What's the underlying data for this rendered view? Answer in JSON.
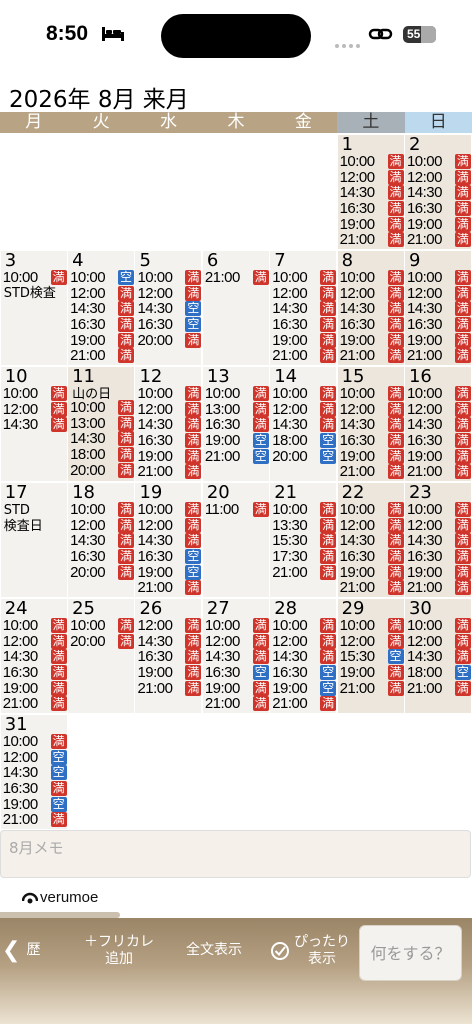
{
  "status_bar": {
    "time": "8:50",
    "battery": "55"
  },
  "month_title": "2026年 8月 来月",
  "weekdays": [
    "月",
    "火",
    "水",
    "木",
    "金",
    "土",
    "日"
  ],
  "calendar": {
    "weeks": [
      [
        null,
        null,
        null,
        null,
        null,
        {
          "day": "1",
          "kind": "weekend",
          "slots": [
            [
              "10:00",
              "満"
            ],
            [
              "12:00",
              "満"
            ],
            [
              "14:30",
              "満"
            ],
            [
              "16:30",
              "満"
            ],
            [
              "19:00",
              "満"
            ],
            [
              "21:00",
              "満"
            ]
          ]
        },
        {
          "day": "2",
          "kind": "weekend",
          "slots": [
            [
              "10:00",
              "満"
            ],
            [
              "12:00",
              "満"
            ],
            [
              "14:30",
              "満"
            ],
            [
              "16:30",
              "満"
            ],
            [
              "19:00",
              "満"
            ],
            [
              "21:00",
              "満"
            ]
          ]
        }
      ],
      [
        {
          "day": "3",
          "slots": [
            [
              "10:00",
              "満"
            ]
          ],
          "label": "STD検査"
        },
        {
          "day": "4",
          "slots": [
            [
              "10:00",
              "空"
            ],
            [
              "12:00",
              "満"
            ],
            [
              "14:30",
              "満"
            ],
            [
              "16:30",
              "満"
            ],
            [
              "19:00",
              "満"
            ],
            [
              "21:00",
              "満"
            ]
          ]
        },
        {
          "day": "5",
          "slots": [
            [
              "10:00",
              "満"
            ],
            [
              "12:00",
              "満"
            ],
            [
              "14:30",
              "空"
            ],
            [
              "16:30",
              "空"
            ],
            [
              "20:00",
              "満"
            ]
          ]
        },
        {
          "day": "6",
          "slots": [
            [
              "21:00",
              "満"
            ]
          ]
        },
        {
          "day": "7",
          "slots": [
            [
              "10:00",
              "満"
            ],
            [
              "12:00",
              "満"
            ],
            [
              "14:30",
              "満"
            ],
            [
              "16:30",
              "満"
            ],
            [
              "19:00",
              "満"
            ],
            [
              "21:00",
              "満"
            ]
          ]
        },
        {
          "day": "8",
          "kind": "weekend",
          "slots": [
            [
              "10:00",
              "満"
            ],
            [
              "12:00",
              "満"
            ],
            [
              "14:30",
              "満"
            ],
            [
              "16:30",
              "満"
            ],
            [
              "19:00",
              "満"
            ],
            [
              "21:00",
              "満"
            ]
          ]
        },
        {
          "day": "9",
          "kind": "weekend",
          "slots": [
            [
              "10:00",
              "満"
            ],
            [
              "12:00",
              "満"
            ],
            [
              "14:30",
              "満"
            ],
            [
              "16:30",
              "満"
            ],
            [
              "19:00",
              "満"
            ],
            [
              "21:00",
              "満"
            ]
          ]
        }
      ],
      [
        {
          "day": "10",
          "slots": [
            [
              "10:00",
              "満"
            ],
            [
              "12:00",
              "満"
            ],
            [
              "14:30",
              "満"
            ]
          ]
        },
        {
          "day": "11",
          "kind": "holiday",
          "label": "山の日",
          "slots": [
            [
              "10:00",
              "満"
            ],
            [
              "13:00",
              "満"
            ],
            [
              "14:30",
              "満"
            ],
            [
              "18:00",
              "満"
            ],
            [
              "20:00",
              "満"
            ]
          ]
        },
        {
          "day": "12",
          "slots": [
            [
              "10:00",
              "満"
            ],
            [
              "12:00",
              "満"
            ],
            [
              "14:30",
              "満"
            ],
            [
              "16:30",
              "満"
            ],
            [
              "19:00",
              "満"
            ],
            [
              "21:00",
              "満"
            ]
          ]
        },
        {
          "day": "13",
          "slots": [
            [
              "10:00",
              "満"
            ],
            [
              "13:00",
              "満"
            ],
            [
              "16:30",
              "満"
            ],
            [
              "19:00",
              "空"
            ],
            [
              "21:00",
              "空"
            ]
          ]
        },
        {
          "day": "14",
          "slots": [
            [
              "10:00",
              "満"
            ],
            [
              "12:00",
              "満"
            ],
            [
              "14:30",
              "満"
            ],
            [
              "18:00",
              "空"
            ],
            [
              "20:00",
              "空"
            ]
          ]
        },
        {
          "day": "15",
          "kind": "weekend",
          "slots": [
            [
              "10:00",
              "満"
            ],
            [
              "12:00",
              "満"
            ],
            [
              "14:30",
              "満"
            ],
            [
              "16:30",
              "満"
            ],
            [
              "19:00",
              "満"
            ],
            [
              "21:00",
              "満"
            ]
          ]
        },
        {
          "day": "16",
          "kind": "weekend",
          "slots": [
            [
              "10:00",
              "満"
            ],
            [
              "12:00",
              "満"
            ],
            [
              "14:30",
              "満"
            ],
            [
              "16:30",
              "満"
            ],
            [
              "19:00",
              "満"
            ],
            [
              "21:00",
              "満"
            ]
          ]
        }
      ],
      [
        {
          "day": "17",
          "slots": [],
          "label": "STD",
          "label2": "検査日"
        },
        {
          "day": "18",
          "slots": [
            [
              "10:00",
              "満"
            ],
            [
              "12:00",
              "満"
            ],
            [
              "14:30",
              "満"
            ],
            [
              "16:30",
              "満"
            ],
            [
              "20:00",
              "満"
            ]
          ]
        },
        {
          "day": "19",
          "slots": [
            [
              "10:00",
              "満"
            ],
            [
              "12:00",
              "満"
            ],
            [
              "14:30",
              "満"
            ],
            [
              "16:30",
              "空"
            ],
            [
              "19:00",
              "空"
            ],
            [
              "21:00",
              "満"
            ]
          ]
        },
        {
          "day": "20",
          "slots": [
            [
              "11:00",
              "満"
            ]
          ]
        },
        {
          "day": "21",
          "slots": [
            [
              "10:00",
              "満"
            ],
            [
              "13:30",
              "満"
            ],
            [
              "15:30",
              "満"
            ],
            [
              "17:30",
              "満"
            ],
            [
              "21:00",
              "満"
            ]
          ]
        },
        {
          "day": "22",
          "kind": "weekend",
          "slots": [
            [
              "10:00",
              "満"
            ],
            [
              "12:00",
              "満"
            ],
            [
              "14:30",
              "満"
            ],
            [
              "16:30",
              "満"
            ],
            [
              "19:00",
              "満"
            ],
            [
              "21:00",
              "満"
            ]
          ]
        },
        {
          "day": "23",
          "kind": "weekend",
          "slots": [
            [
              "10:00",
              "満"
            ],
            [
              "12:00",
              "満"
            ],
            [
              "14:30",
              "満"
            ],
            [
              "16:30",
              "満"
            ],
            [
              "19:00",
              "満"
            ],
            [
              "21:00",
              "満"
            ]
          ]
        }
      ],
      [
        {
          "day": "24",
          "slots": [
            [
              "10:00",
              "満"
            ],
            [
              "12:00",
              "満"
            ],
            [
              "14:30",
              "満"
            ],
            [
              "16:30",
              "満"
            ],
            [
              "19:00",
              "満"
            ],
            [
              "21:00",
              "満"
            ]
          ]
        },
        {
          "day": "25",
          "slots": [
            [
              "10:00",
              "満"
            ],
            [
              "20:00",
              "満"
            ]
          ]
        },
        {
          "day": "26",
          "slots": [
            [
              "12:00",
              "満"
            ],
            [
              "14:30",
              "満"
            ],
            [
              "16:30",
              "満"
            ],
            [
              "19:00",
              "満"
            ],
            [
              "21:00",
              "満"
            ]
          ]
        },
        {
          "day": "27",
          "slots": [
            [
              "10:00",
              "満"
            ],
            [
              "12:00",
              "満"
            ],
            [
              "14:30",
              "満"
            ],
            [
              "16:30",
              "空"
            ],
            [
              "19:00",
              "満"
            ],
            [
              "21:00",
              "満"
            ]
          ]
        },
        {
          "day": "28",
          "slots": [
            [
              "10:00",
              "満"
            ],
            [
              "12:00",
              "満"
            ],
            [
              "14:30",
              "満"
            ],
            [
              "16:30",
              "空"
            ],
            [
              "19:00",
              "空"
            ],
            [
              "21:00",
              "満"
            ]
          ]
        },
        {
          "day": "29",
          "kind": "weekend",
          "slots": [
            [
              "10:00",
              "満"
            ],
            [
              "12:00",
              "満"
            ],
            [
              "15:30",
              "空"
            ],
            [
              "19:00",
              "満"
            ],
            [
              "21:00",
              "満"
            ]
          ]
        },
        {
          "day": "30",
          "kind": "weekend",
          "slots": [
            [
              "10:00",
              "満"
            ],
            [
              "12:00",
              "満"
            ],
            [
              "14:30",
              "満"
            ],
            [
              "18:00",
              "空"
            ],
            [
              "21:00",
              "満"
            ]
          ]
        }
      ],
      [
        {
          "day": "31",
          "slots": [
            [
              "10:00",
              "満"
            ],
            [
              "12:00",
              "空"
            ],
            [
              "14:30",
              "空"
            ],
            [
              "16:30",
              "満"
            ],
            [
              "19:00",
              "空"
            ],
            [
              "21:00",
              "満"
            ]
          ]
        },
        null,
        null,
        null,
        null,
        null,
        null
      ]
    ]
  },
  "memo_placeholder": "8月メモ",
  "logo_text": "verumoe",
  "toolbar": {
    "back": "歴",
    "add_line1": "＋フリカレ",
    "add_line2": "追加",
    "fulltext": "全文表示",
    "fit_line1": "ぴったり",
    "fit_line2": "表示",
    "what": "何をする？"
  },
  "colors": {
    "full": "#d0352c",
    "open": "#2f6fc4",
    "accent": "#b8a484"
  }
}
